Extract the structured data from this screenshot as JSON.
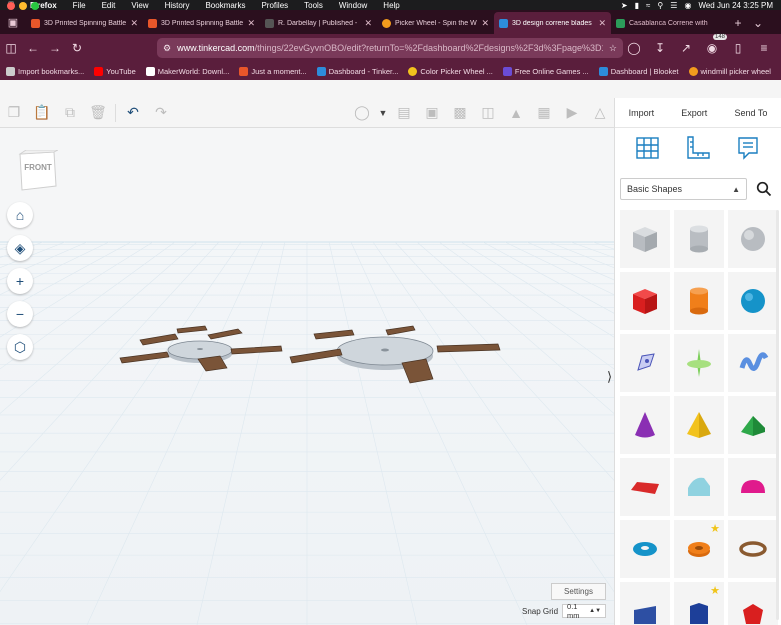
{
  "menubar": {
    "app": "Firefox",
    "items": [
      "File",
      "Edit",
      "View",
      "History",
      "Bookmarks",
      "Profiles",
      "Tools",
      "Window",
      "Help"
    ],
    "clock": "Wed Jun 24  3:25 PM"
  },
  "tabs": [
    {
      "title": "3D Printed Spinning Battle",
      "favicon_color": "#e8562a",
      "active": false
    },
    {
      "title": "3D Printed Spinning Battle",
      "favicon_color": "#e8562a",
      "active": false
    },
    {
      "title": "R. Darbellay | Published -",
      "favicon_color": "#555555",
      "active": false
    },
    {
      "title": "Picker Wheel - Spin the W",
      "favicon_color": "#f29b1d",
      "active": false
    },
    {
      "title": "3D design correne blades",
      "favicon_color": "#2d8cdb",
      "active": true
    },
    {
      "title": "Casablanca Correne with",
      "favicon_color": "#2c9c5a",
      "active": false
    }
  ],
  "urlbar": {
    "host": "www.tinkercad.com",
    "path": "/things/22evGyvnOBO/edit?returnTo=%2Fdashboard%2Fdesigns%2F3d%3Fpage%3D1"
  },
  "extension_badge": "148",
  "bookmarks": [
    {
      "label": "Import bookmarks...",
      "color": "#cccccc"
    },
    {
      "label": "YouTube",
      "color": "#ff0000"
    },
    {
      "label": "MakerWorld: Downl...",
      "color": "#ffffff"
    },
    {
      "label": "Just a moment...",
      "color": "#e8562a"
    },
    {
      "label": "Dashboard - Tinker...",
      "color": "#2d8cdb"
    },
    {
      "label": "Color Picker Wheel ...",
      "color": "#f2c21d"
    },
    {
      "label": "Free Online Games ...",
      "color": "#6b4cd6"
    },
    {
      "label": "Dashboard | Blooket",
      "color": "#2d8cdb"
    },
    {
      "label": "windmill picker wheel",
      "color": "#f29b1d"
    }
  ],
  "panel": {
    "import_label": "Import",
    "export_label": "Export",
    "sendto_label": "Send To",
    "shape_category": "Basic Shapes"
  },
  "viewcube_label": "FRONT",
  "settings_label": "Settings",
  "snap": {
    "label": "Snap Grid",
    "value": "0.1 mm"
  },
  "colors": {
    "brand": "#1f4e79",
    "browser_frame": "#5a1e3c",
    "workplane": "#f2f5f7"
  }
}
